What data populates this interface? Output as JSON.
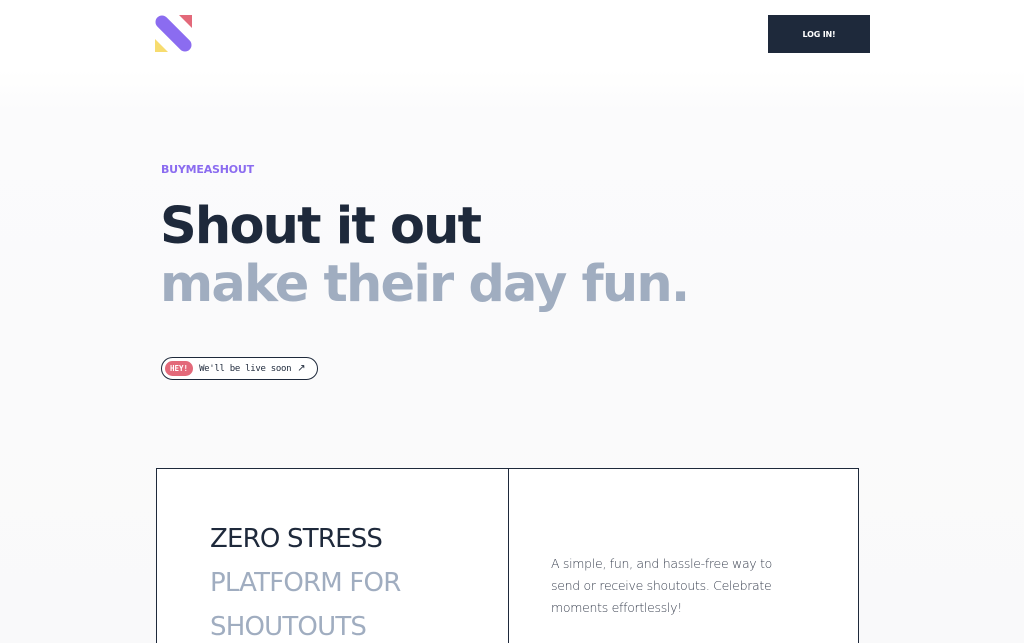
{
  "header": {
    "logo_icon": "buymeashout-logo-icon",
    "login_label": "LOG IN!"
  },
  "hero": {
    "eyebrow": "BUYMEASHOUT",
    "headline_line1": "Shout it out",
    "headline_line2": "make their day fun.",
    "pill": {
      "badge": "HEY!",
      "text": "We'll be live soon",
      "arrow": "↗"
    }
  },
  "feature": {
    "title_line1": "ZERO STRESS",
    "title_line2": "PLATFORM FOR",
    "title_line3": "SHOUTOUTS",
    "description": "A simple, fun, and hassle-free way to send or receive shoutouts. Celebrate moments effortlessly!"
  },
  "colors": {
    "accent_purple": "#8b6cf0",
    "navy": "#1e293b",
    "slate": "#a0adc0",
    "badge_pink": "#e3697a",
    "logo_yellow": "#f7dc6f",
    "logo_red": "#e3697a"
  }
}
